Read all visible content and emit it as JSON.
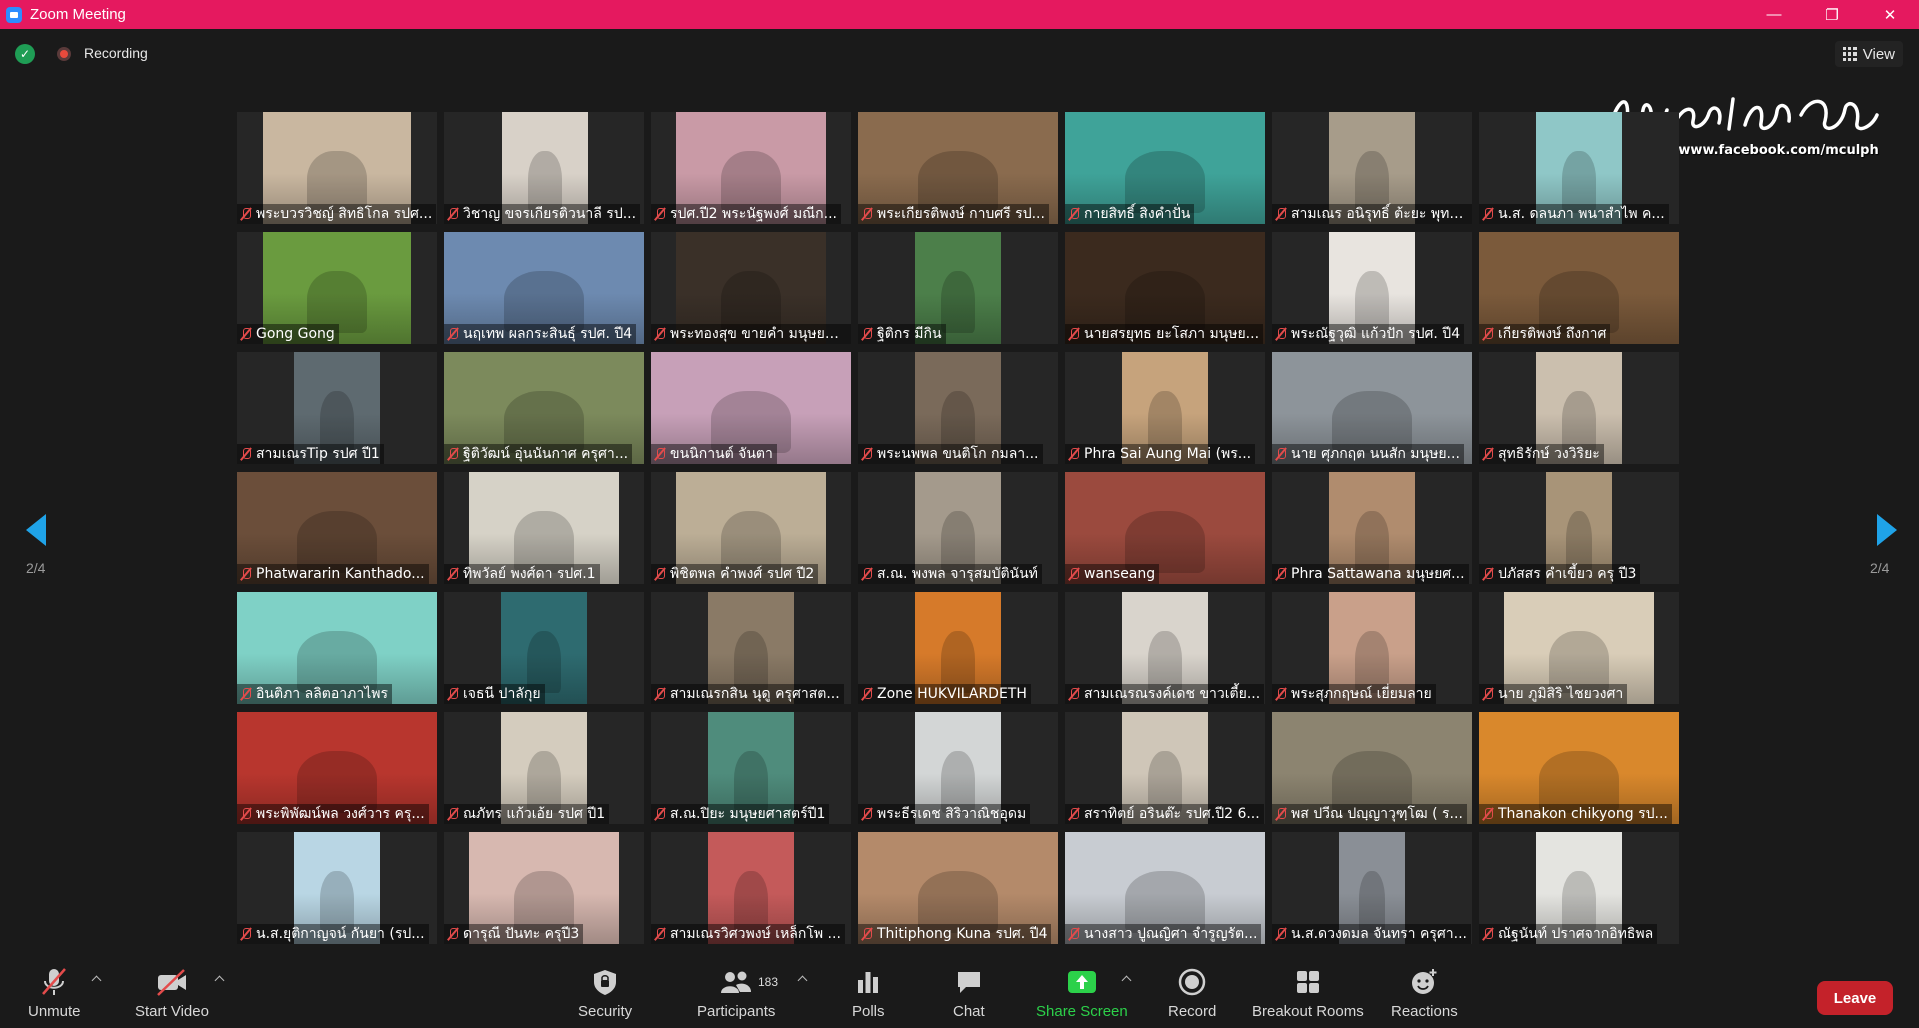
{
  "window": {
    "title": "Zoom Meeting",
    "minimize": "—",
    "restore": "❐",
    "close": "✕"
  },
  "topbar": {
    "recording_label": "Recording",
    "view_label": "View"
  },
  "watermark": {
    "signature": "วิทยาพงษ์ เป้าฟูเฒ",
    "url": "https://www.facebook.com/mculph"
  },
  "pagination": {
    "left": "2/4",
    "right": "2/4"
  },
  "participants": [
    {
      "name": "พระบวรวิชญ์ สิทธิโกล รปศ...",
      "bg": "#c9b7a0"
    },
    {
      "name": "วิชาญ ขจรเกียรติวนาลี รป...",
      "bg": "#d8d1c8"
    },
    {
      "name": "รปศ.ปี2 พระนัฐพงศ์ มณีก...",
      "bg": "#c99aa6"
    },
    {
      "name": "พระเกียรติพงษ์ กาบศรี รป...",
      "bg": "#8a6b4e"
    },
    {
      "name": "กายสิทธิ์ สิงคำปั่น",
      "bg": "#3fa399"
    },
    {
      "name": "สามเณร อนิรุทธิ์ ต้ะยะ พุทธ...",
      "bg": "#a79c8a"
    },
    {
      "name": "น.ส. ดลนภา พนาสำไพ ค...",
      "bg": "#8fc7c7"
    },
    {
      "name": "Gong Gong",
      "bg": "#6a9b3f"
    },
    {
      "name": "นฤเทพ ผลกระสินธุ์ รปศ. ปี4",
      "bg": "#6d8ab0"
    },
    {
      "name": "พระทองสุข ขายคำ มนุษยศ...",
      "bg": "#3a3028"
    },
    {
      "name": "ฐิติกร มีกิน",
      "bg": "#4c7f4a"
    },
    {
      "name": "นายสรยุทธ ยะโสภา มนุษย...",
      "bg": "#3b2a1e"
    },
    {
      "name": "พระณัฐวุฒิ แก้วปัก รปศ. ปี4",
      "bg": "#e8e4df"
    },
    {
      "name": "เกียรติพงษ์ ถึงกาศ",
      "bg": "#7b5a3b"
    },
    {
      "name": "สามเณรTip รปศ ปี1",
      "bg": "#5e6a70"
    },
    {
      "name": "ฐิติวัฒน์ อุ่นนันกาศ ครุศา...",
      "bg": "#7c8a5c"
    },
    {
      "name": "ขนนิกานต์ จันตา",
      "bg": "#c7a0b8"
    },
    {
      "name": "พระนพพล ขนติโก กมลา...",
      "bg": "#7a6a5a"
    },
    {
      "name": "Phra Sai Aung Mai (พร...",
      "bg": "#c6a37c"
    },
    {
      "name": "นาย ศุภกฤต นนสัก มนุษย...",
      "bg": "#8d949a"
    },
    {
      "name": "สุทธิรักษ์ วงวิริยะ",
      "bg": "#cbbfae"
    },
    {
      "name": "Phatwararin Kanthado...",
      "bg": "#6b4e3a"
    },
    {
      "name": "ทิพวัลย์ พงศ์ดา รปศ.1",
      "bg": "#d6d2c7"
    },
    {
      "name": "พิชิตพล คำพงศ์ รปศ ปี2",
      "bg": "#bcae96"
    },
    {
      "name": "ส.ณ. พงพล จารุสมบัตินันท์",
      "bg": "#a49a8c"
    },
    {
      "name": "wanseang",
      "bg": "#9b4a3e"
    },
    {
      "name": "Phra Sattawana มนุษยศ...",
      "bg": "#b08c6e"
    },
    {
      "name": "ปภัสสร คำเขี้ยว ครุ ปี3",
      "bg": "#a89478"
    },
    {
      "name": "อินติภา ลลิตอาภาไพร",
      "bg": "#7fd1c6"
    },
    {
      "name": "เจธนี ปาลักุย",
      "bg": "#2e6b70"
    },
    {
      "name": "สามเณรกสิน นุดู ครุศาสต...",
      "bg": "#8a7a66"
    },
    {
      "name": "Zone HUKVILARDETH",
      "bg": "#d67a2a"
    },
    {
      "name": "สามเณรณรงค์เดช ขาวเตี้ย...",
      "bg": "#d9d4cc"
    },
    {
      "name": "พระสุภกฤษณ์ เยี่ยมลาย",
      "bg": "#c9a08a"
    },
    {
      "name": "นาย ภูมิสิริ ไชยวงศา",
      "bg": "#d9cdb8"
    },
    {
      "name": "พระพิพัฒน์พล วงศ์วาร ครุ...",
      "bg": "#b8362e"
    },
    {
      "name": "ณภัทร แก้วเอ้ย รปศ ปี1",
      "bg": "#d4ccbe"
    },
    {
      "name": "ส.ณ.ปิยะ มนุษยศาสตร์ปี1",
      "bg": "#4f8c7c"
    },
    {
      "name": "พระธีรเดช สิริวาณิชอุดม",
      "bg": "#d3d6d6"
    },
    {
      "name": "สราทิตย์ อรินต๊ะ รปศ.ปี2 6...",
      "bg": "#cfc6b8"
    },
    {
      "name": "พส ปวีณ ปญฺญาวุฑฺโฒ ( ร...",
      "bg": "#8c8470"
    },
    {
      "name": "Thanakon chikyong รป...",
      "bg": "#d9882c"
    },
    {
      "name": "น.ส.ยุติกาญจน์ กันยา (รป...",
      "bg": "#b9d6e4"
    },
    {
      "name": "ดารุณี ปันทะ ครุปี3",
      "bg": "#d7b8b0"
    },
    {
      "name": "สามเณรวิศวพงษ์ เหล็กโพ ...",
      "bg": "#c45a5a"
    },
    {
      "name": "Thitiphong Kuna รปศ. ปี4",
      "bg": "#b48a6a"
    },
    {
      "name": "นางสาว ปูณญิศา จำรูญรัต...",
      "bg": "#c8ccd2"
    },
    {
      "name": "น.ส.ดวงดมล จันทรา ครุศา...",
      "bg": "#8a8f96"
    },
    {
      "name": "ณัฐนันท์ ปราศจากอิทธิพล",
      "bg": "#e4e4e0"
    }
  ],
  "toolbar": {
    "unmute": "Unmute",
    "start_video": "Start Video",
    "security": "Security",
    "participants": "Participants",
    "participant_count": "183",
    "polls": "Polls",
    "chat": "Chat",
    "share_screen": "Share Screen",
    "record": "Record",
    "breakout_rooms": "Breakout Rooms",
    "reactions": "Reactions",
    "leave": "Leave"
  }
}
